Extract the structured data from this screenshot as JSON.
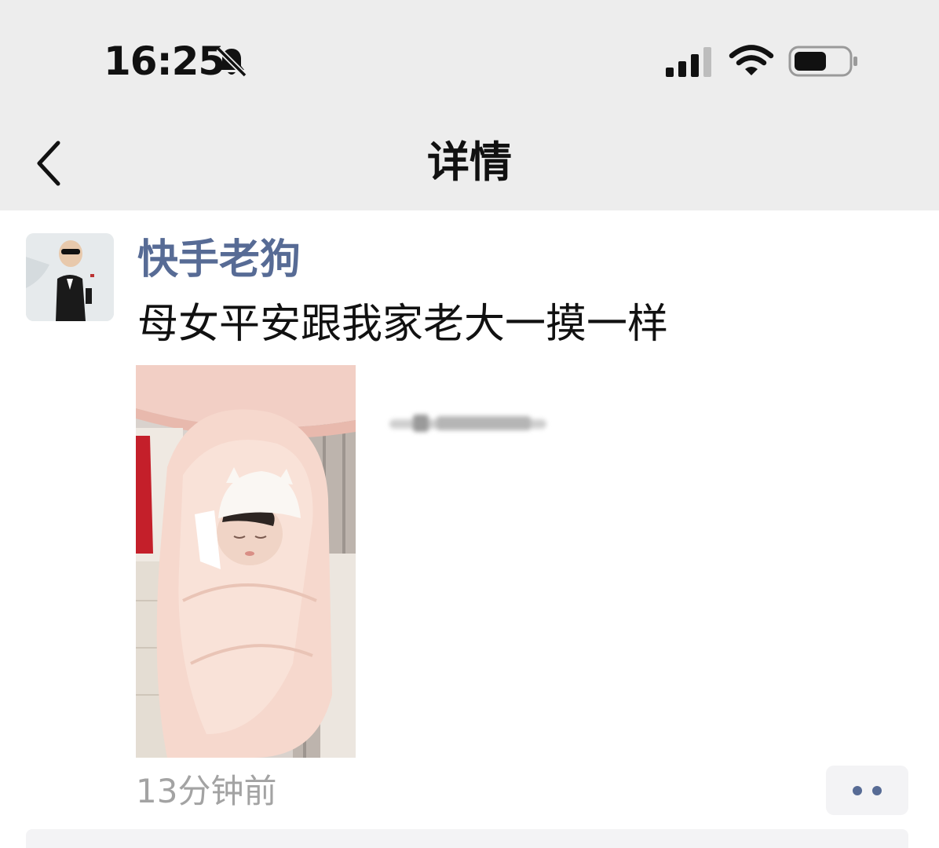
{
  "status_bar": {
    "time": "16:25",
    "icons": [
      "bell-muted-icon",
      "cellular-signal-icon",
      "wifi-icon",
      "battery-icon"
    ]
  },
  "nav": {
    "back_icon": "chevron-left-icon",
    "title": "详情"
  },
  "post": {
    "username": "快手老狗",
    "text": "母女平安跟我家老大一摸一样",
    "timestamp": "13分钟前",
    "more_icon": "two-dots-icon"
  },
  "colors": {
    "top_background": "#ededed",
    "username": "#576b95",
    "timestamp": "#a3a3a3",
    "more_button_bg": "#f3f3f5"
  }
}
